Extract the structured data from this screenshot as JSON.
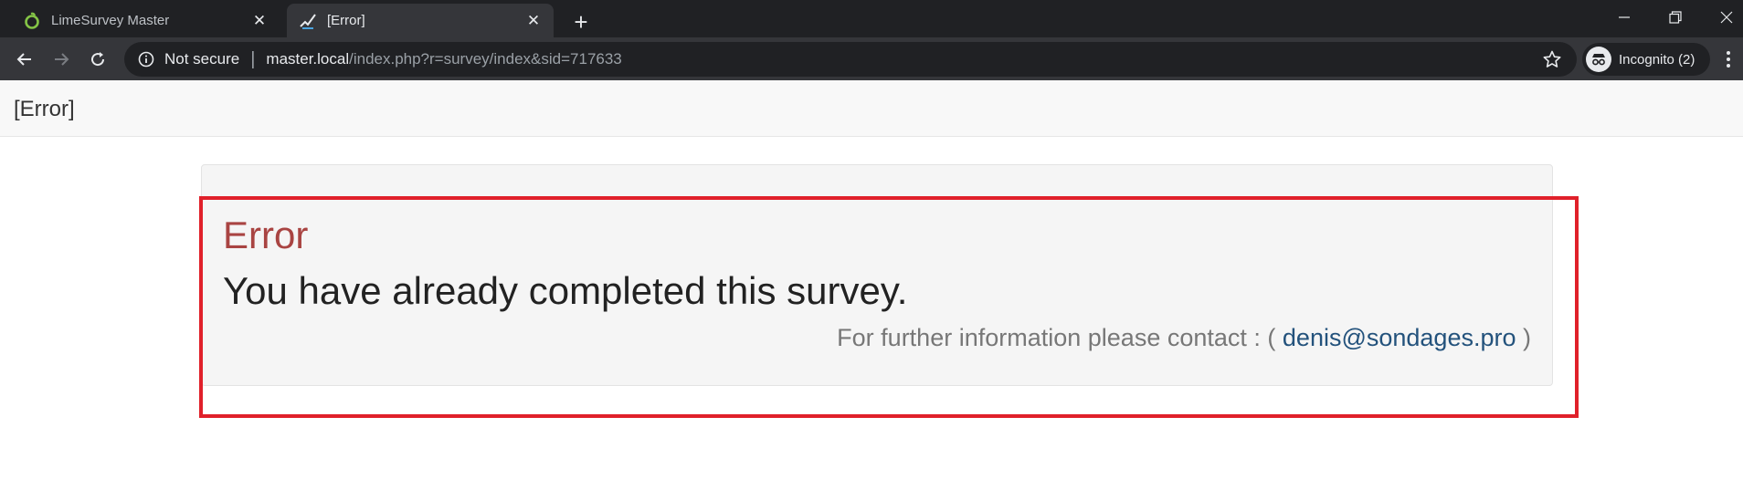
{
  "browser": {
    "tabs": [
      {
        "title": "LimeSurvey Master",
        "active": false
      },
      {
        "title": "[Error]",
        "active": true
      }
    ],
    "new_tab_symbol": "+",
    "close_symbol": "✕",
    "security_label": "Not secure",
    "url_host": "master.local",
    "url_path": "/index.php?r=survey/index&sid=717633",
    "incognito_label": "Incognito (2)",
    "icons": [
      "limesurvey-favicon",
      "error-favicon",
      "close-icon",
      "plus-icon",
      "minimize-icon",
      "restore-icon",
      "window-close-icon",
      "back-arrow-icon",
      "forward-arrow-icon",
      "reload-icon",
      "info-icon",
      "star-icon",
      "incognito-icon",
      "kebab-menu-icon"
    ]
  },
  "page": {
    "header_title": "[Error]",
    "error_heading": "Error",
    "error_message": "You have already completed this survey.",
    "contact_prefix": "For further information please contact : (",
    "contact_email": "denis@sondages.pro",
    "contact_suffix": ")"
  },
  "colors": {
    "tabbar_bg": "#202124",
    "toolbar_bg": "#35363a",
    "error_heading": "#a94442",
    "highlight_border": "#e0202a",
    "link": "#23527c"
  }
}
